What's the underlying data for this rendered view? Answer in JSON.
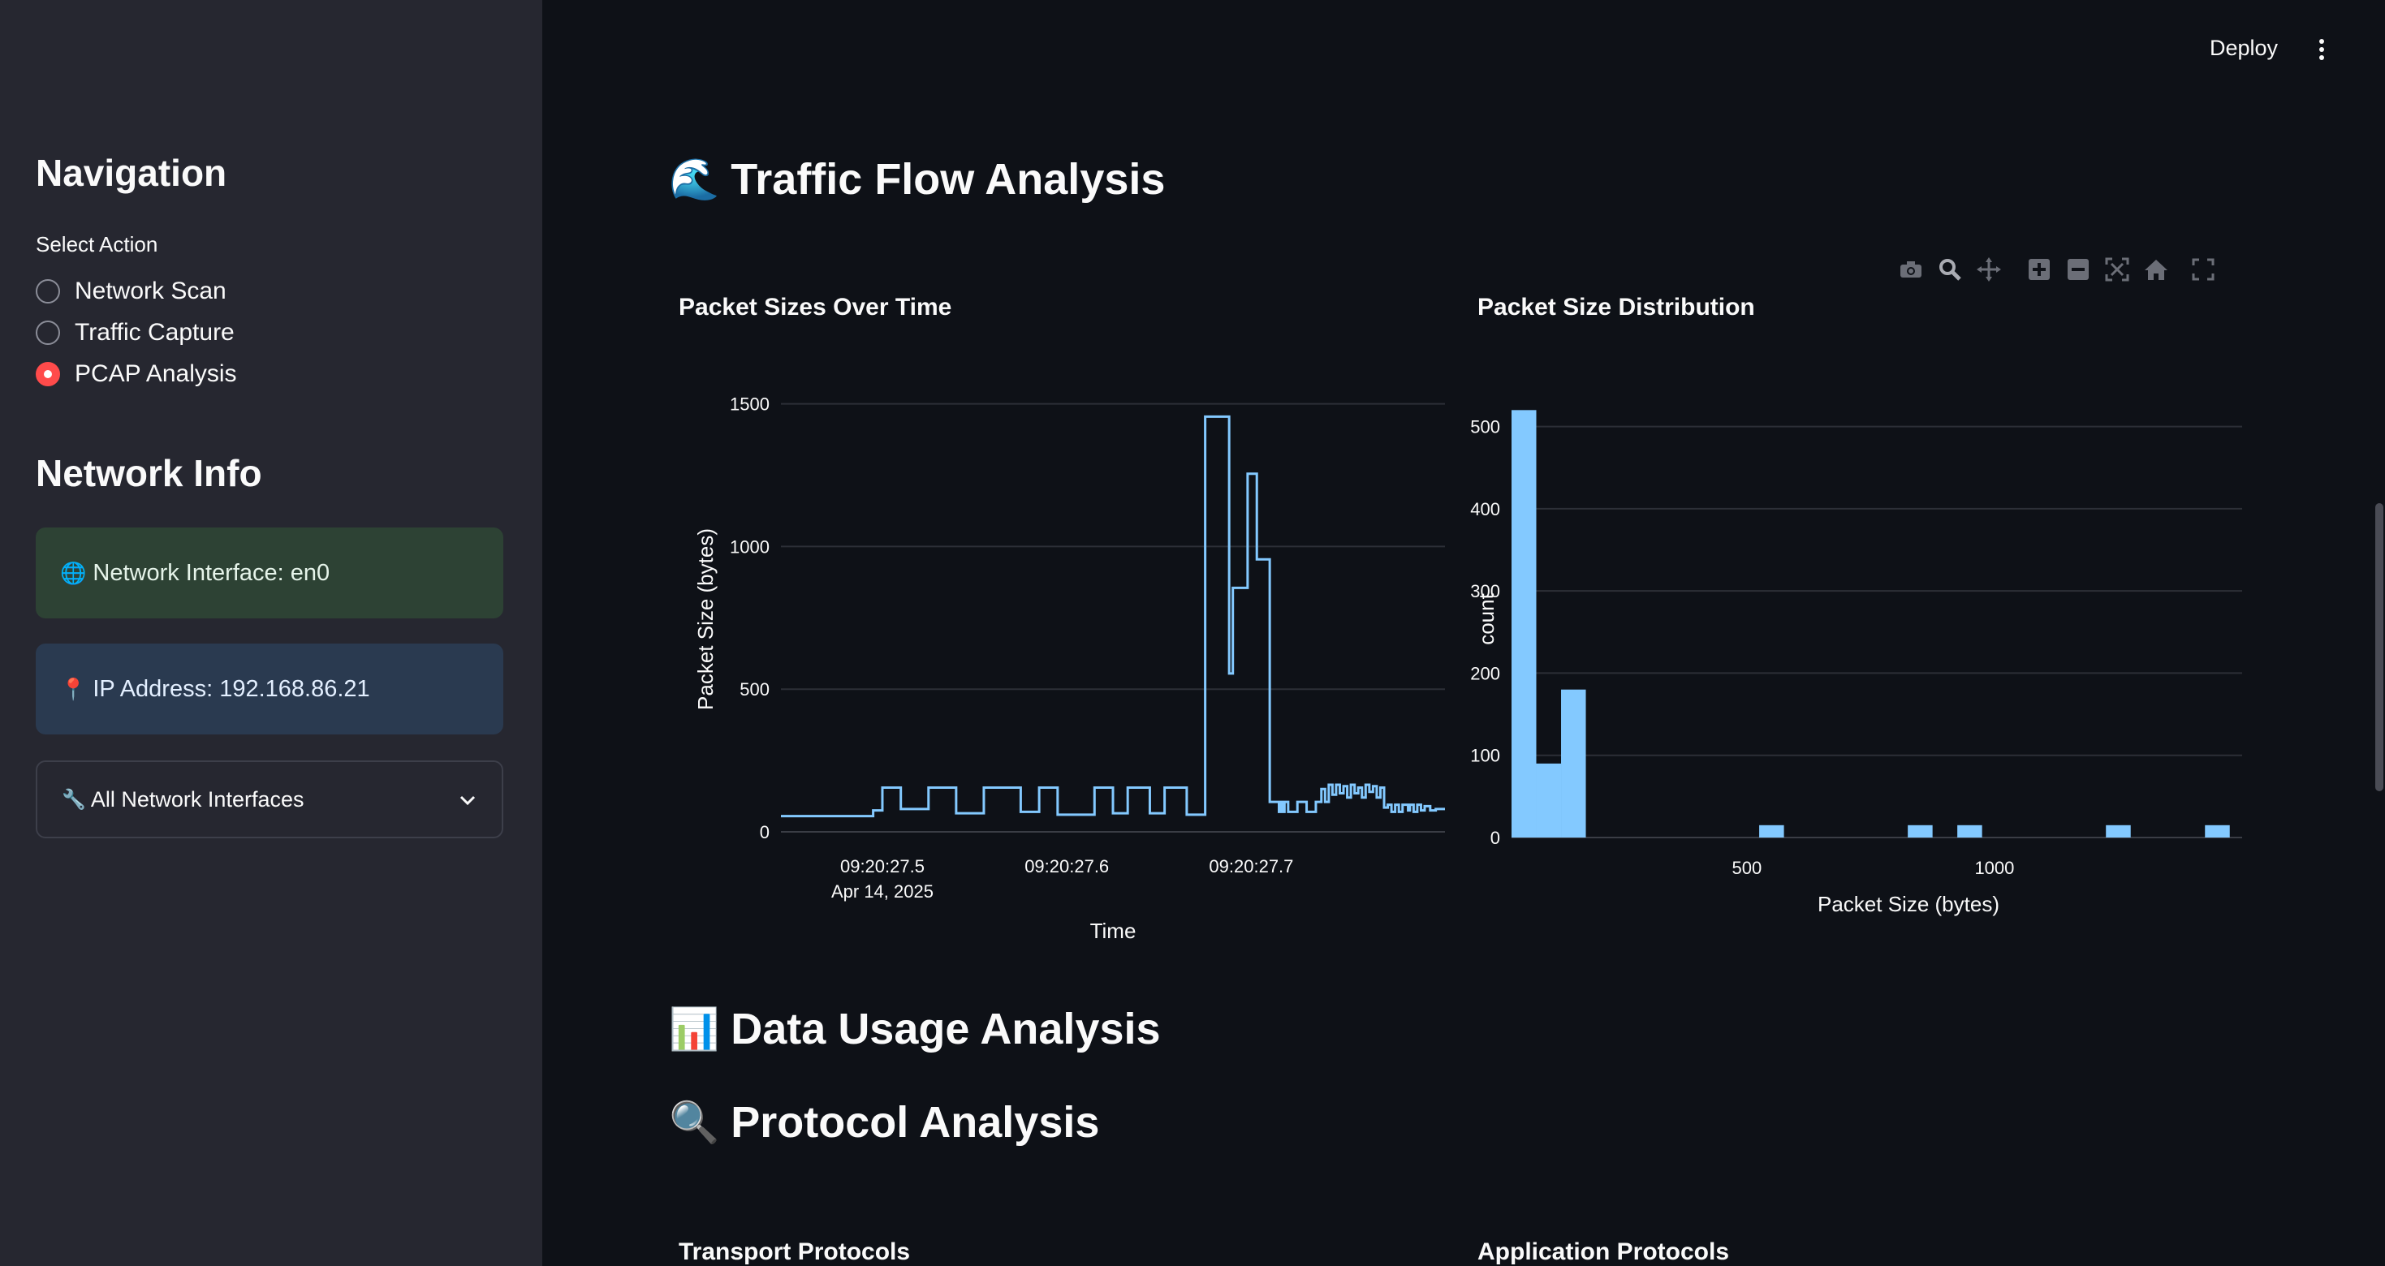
{
  "sidebar": {
    "nav_title": "Navigation",
    "select_label": "Select Action",
    "options": [
      {
        "label": "Network Scan",
        "checked": false
      },
      {
        "label": "Traffic Capture",
        "checked": false
      },
      {
        "label": "PCAP Analysis",
        "checked": true
      }
    ],
    "info_title": "Network Info",
    "interface_emoji": "🌐",
    "interface_text": "Network Interface: en0",
    "ip_emoji": "📍",
    "ip_text": "IP Address: 192.168.86.21",
    "expander_emoji": "🔧",
    "expander_label": "All Network Interfaces"
  },
  "header": {
    "deploy_label": "Deploy"
  },
  "main": {
    "traffic_emoji": "🌊",
    "traffic_title": "Traffic Flow Analysis",
    "data_usage_emoji": "📊",
    "data_usage_title": "Data Usage Analysis",
    "protocol_emoji": "🔍",
    "protocol_title": "Protocol Analysis",
    "transport_title": "Transport Protocols",
    "application_title": "Application Protocols"
  },
  "toolbar_icons": [
    "camera-icon",
    "zoom-icon",
    "pan-icon",
    "zoom-in-icon",
    "zoom-out-icon",
    "autoscale-icon",
    "reset-axes-icon",
    "fullscreen-icon"
  ],
  "colors": {
    "sidebar_bg": "#262730",
    "main_bg": "#0e1117",
    "accent": "#ff4b4b",
    "series": "#83c9ff"
  },
  "chart_data": [
    {
      "type": "line",
      "title": "Packet Sizes Over Time",
      "xlabel": "Time",
      "ylabel": "Packet Size (bytes)",
      "x_ticks": [
        "09:20:27.5",
        "09:20:27.6",
        "09:20:27.7"
      ],
      "x_tick_sub": "Apr 14, 2025",
      "y_ticks": [
        0,
        500,
        1000,
        1500
      ],
      "ylim": [
        0,
        1550
      ],
      "line_shape": "hv",
      "grid": true,
      "x_seconds": [
        27.445,
        27.485,
        27.495,
        27.5,
        27.505,
        27.51,
        27.525,
        27.54,
        27.545,
        27.555,
        27.575,
        27.585,
        27.595,
        27.615,
        27.625,
        27.633,
        27.645,
        27.653,
        27.665,
        27.675,
        27.688,
        27.69,
        27.698,
        27.703,
        27.71,
        27.715,
        27.716,
        27.717,
        27.718,
        27.72,
        27.725,
        27.73,
        27.735,
        27.738,
        27.74,
        27.742,
        27.744,
        27.746,
        27.748,
        27.75,
        27.752,
        27.754,
        27.756,
        27.758,
        27.76,
        27.762,
        27.764,
        27.766,
        27.768,
        27.77,
        27.772,
        27.774,
        27.776,
        27.778,
        27.78,
        27.782,
        27.785,
        27.786,
        27.788,
        27.79,
        27.792,
        27.794,
        27.797,
        27.8,
        27.805
      ],
      "y_values": [
        55,
        55,
        75,
        155,
        155,
        80,
        155,
        65,
        65,
        155,
        70,
        155,
        60,
        155,
        65,
        155,
        65,
        155,
        60,
        1455,
        555,
        855,
        1255,
        955,
        105,
        70,
        105,
        70,
        105,
        70,
        105,
        70,
        105,
        150,
        105,
        165,
        130,
        165,
        135,
        160,
        120,
        165,
        135,
        155,
        120,
        165,
        140,
        160,
        120,
        155,
        85,
        95,
        70,
        95,
        70,
        95,
        75,
        95,
        70,
        95,
        75,
        90,
        75,
        80,
        80
      ]
    },
    {
      "type": "bar",
      "title": "Packet Size Distribution",
      "xlabel": "Packet Size (bytes)",
      "ylabel": "count",
      "x_ticks": [
        500,
        1000
      ],
      "y_ticks": [
        0,
        100,
        200,
        300,
        400,
        500
      ],
      "ylim": [
        0,
        545
      ],
      "bin_width": 50,
      "bins": [
        {
          "x": 50,
          "count": 520
        },
        {
          "x": 100,
          "count": 90
        },
        {
          "x": 150,
          "count": 180
        },
        {
          "x": 550,
          "count": 15
        },
        {
          "x": 850,
          "count": 15
        },
        {
          "x": 950,
          "count": 15
        },
        {
          "x": 1250,
          "count": 15
        },
        {
          "x": 1450,
          "count": 15
        }
      ]
    }
  ]
}
